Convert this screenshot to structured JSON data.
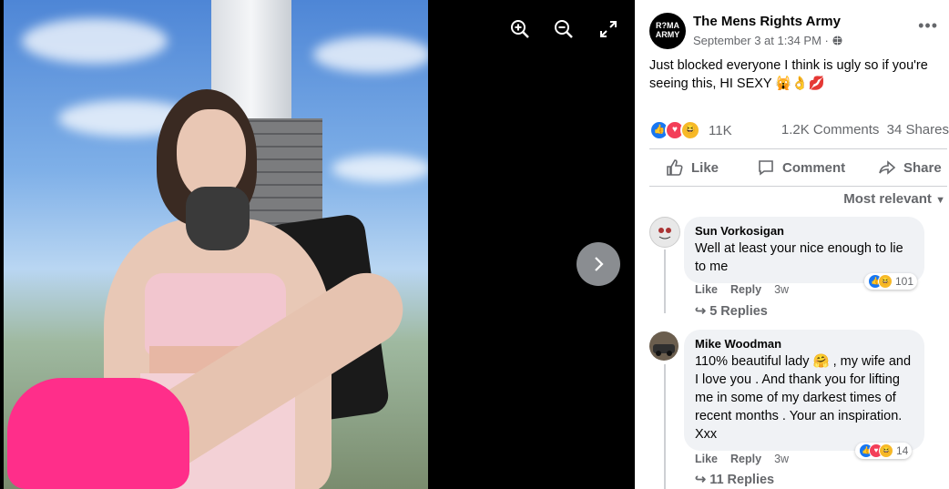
{
  "viewer": {
    "zoom_in_icon": "zoom-in-icon",
    "zoom_out_icon": "zoom-out-icon",
    "fullscreen_icon": "fullscreen-icon",
    "next_icon": "chevron-right-icon"
  },
  "post": {
    "page_avatar_text": "R?MA ARMY",
    "page_name": "The Mens Rights Army",
    "timestamp": "September 3 at 1:34 PM",
    "audience_icon": "globe-icon",
    "text": "Just blocked everyone I think is ugly so if you're seeing this, HI SEXY",
    "emojis": "🙀👌💋",
    "reaction_count": "11K",
    "comments_count": "1.2K Comments",
    "shares_count": "34 Shares"
  },
  "actions": {
    "like": "Like",
    "comment": "Comment",
    "share": "Share"
  },
  "sort_label": "Most relevant",
  "comments": [
    {
      "name": "Sun Vorkosigan",
      "text": "Well at least your nice enough to lie to me",
      "like": "Like",
      "reply": "Reply",
      "time": "3w",
      "reactions": "101",
      "replies": "5 Replies"
    },
    {
      "name": "Mike Woodman",
      "text": "110% beautiful lady 🤗 , my wife and I love you . And thank you for lifting me in some of my darkest times of recent months . Your an inspiration. Xxx",
      "like": "Like",
      "reply": "Reply",
      "time": "3w",
      "reactions": "14",
      "replies": "11 Replies"
    }
  ]
}
